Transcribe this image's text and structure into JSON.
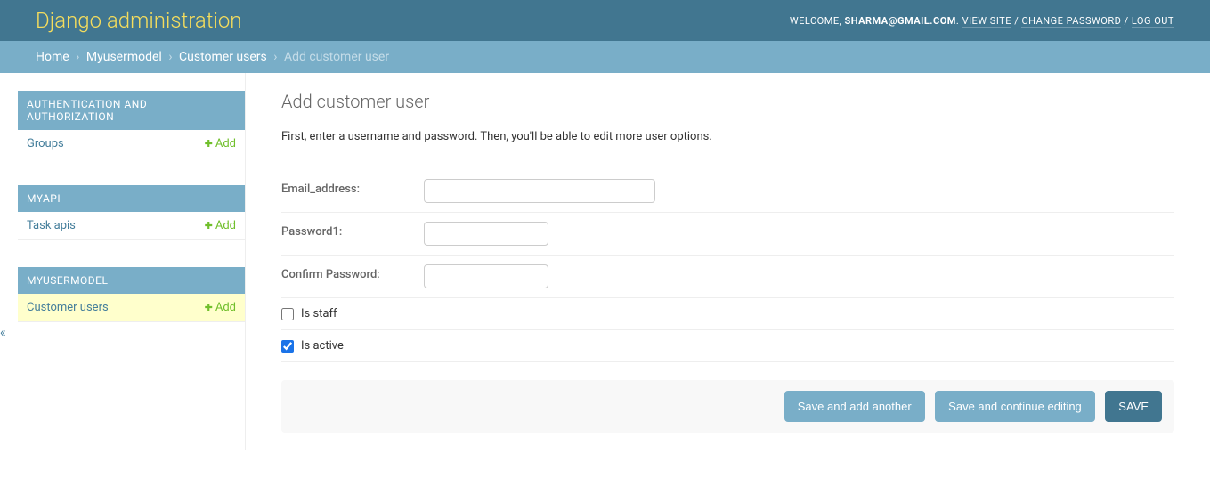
{
  "header": {
    "site_title": "Django administration",
    "welcome": "WELCOME, ",
    "username": "SHARMA@GMAIL.COM",
    "view_site": "VIEW SITE",
    "change_password": "CHANGE PASSWORD",
    "log_out": "LOG OUT",
    "sep": " / "
  },
  "breadcrumbs": {
    "home": "Home",
    "app": "Myusermodel",
    "model": "Customer users",
    "current": "Add customer user",
    "sep": "›"
  },
  "sidebar": {
    "toggle": "«",
    "apps": [
      {
        "label": "AUTHENTICATION AND AUTHORIZATION",
        "models": [
          {
            "name": "Groups",
            "add": "Add",
            "current": false
          }
        ]
      },
      {
        "label": "MYAPI",
        "models": [
          {
            "name": "Task apis",
            "add": "Add",
            "current": false
          }
        ]
      },
      {
        "label": "MYUSERMODEL",
        "models": [
          {
            "name": "Customer users",
            "add": "Add",
            "current": true
          }
        ]
      }
    ]
  },
  "content": {
    "title": "Add customer user",
    "intro": "First, enter a username and password. Then, you'll be able to edit more user options.",
    "fields": {
      "email_label": "Email_address:",
      "password1_label": "Password1:",
      "password2_label": "Confirm Password:",
      "is_staff_label": "Is staff",
      "is_active_label": "Is active",
      "is_staff_checked": false,
      "is_active_checked": true
    },
    "submit": {
      "save_add_another": "Save and add another",
      "save_continue": "Save and continue editing",
      "save": "SAVE"
    }
  }
}
